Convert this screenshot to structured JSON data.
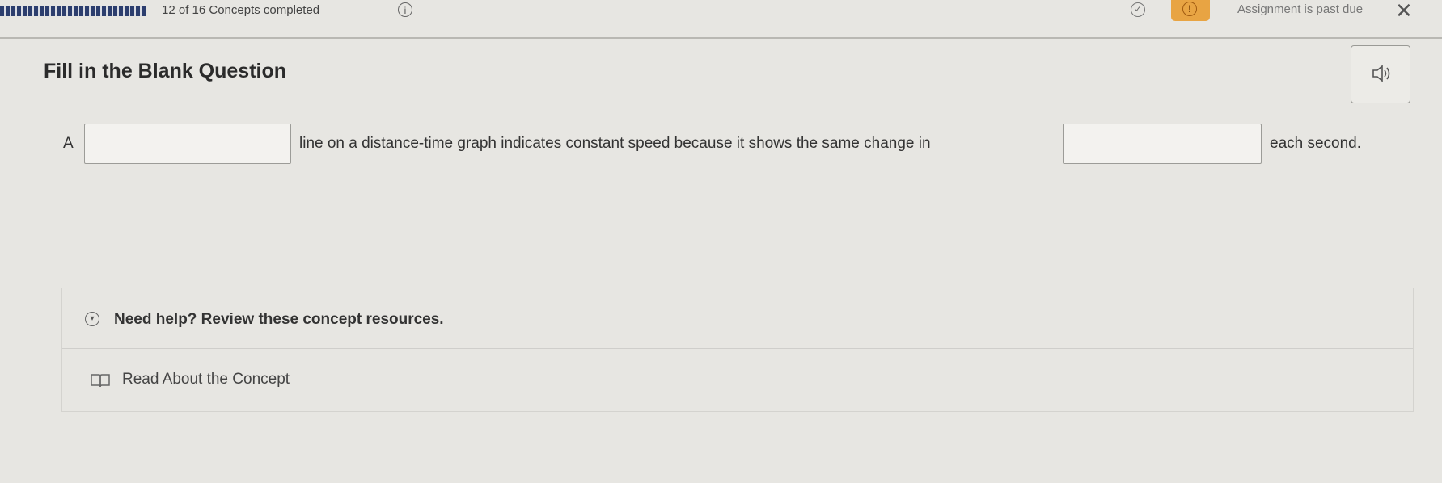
{
  "header": {
    "progress_text": "12 of 16 Concepts completed",
    "info_icon": "i",
    "status_text": "Assignment is past due",
    "warning_icon": "!",
    "close_icon": "✕"
  },
  "question": {
    "title": "Fill in the Blank Question",
    "speaker_icon": "speaker-icon",
    "parts": {
      "before": "A",
      "middle": "line on a distance-time graph indicates constant speed because it shows the same change in",
      "after": "each second."
    },
    "blank1_value": "",
    "blank2_value": ""
  },
  "help": {
    "toggle_label": "Need help? Review these concept resources.",
    "resources": [
      {
        "label": "Read About the Concept",
        "icon": "book-icon"
      }
    ]
  },
  "colors": {
    "background": "#e7e6e2",
    "warning": "#e8a443",
    "progress": "#2c3e6e"
  }
}
